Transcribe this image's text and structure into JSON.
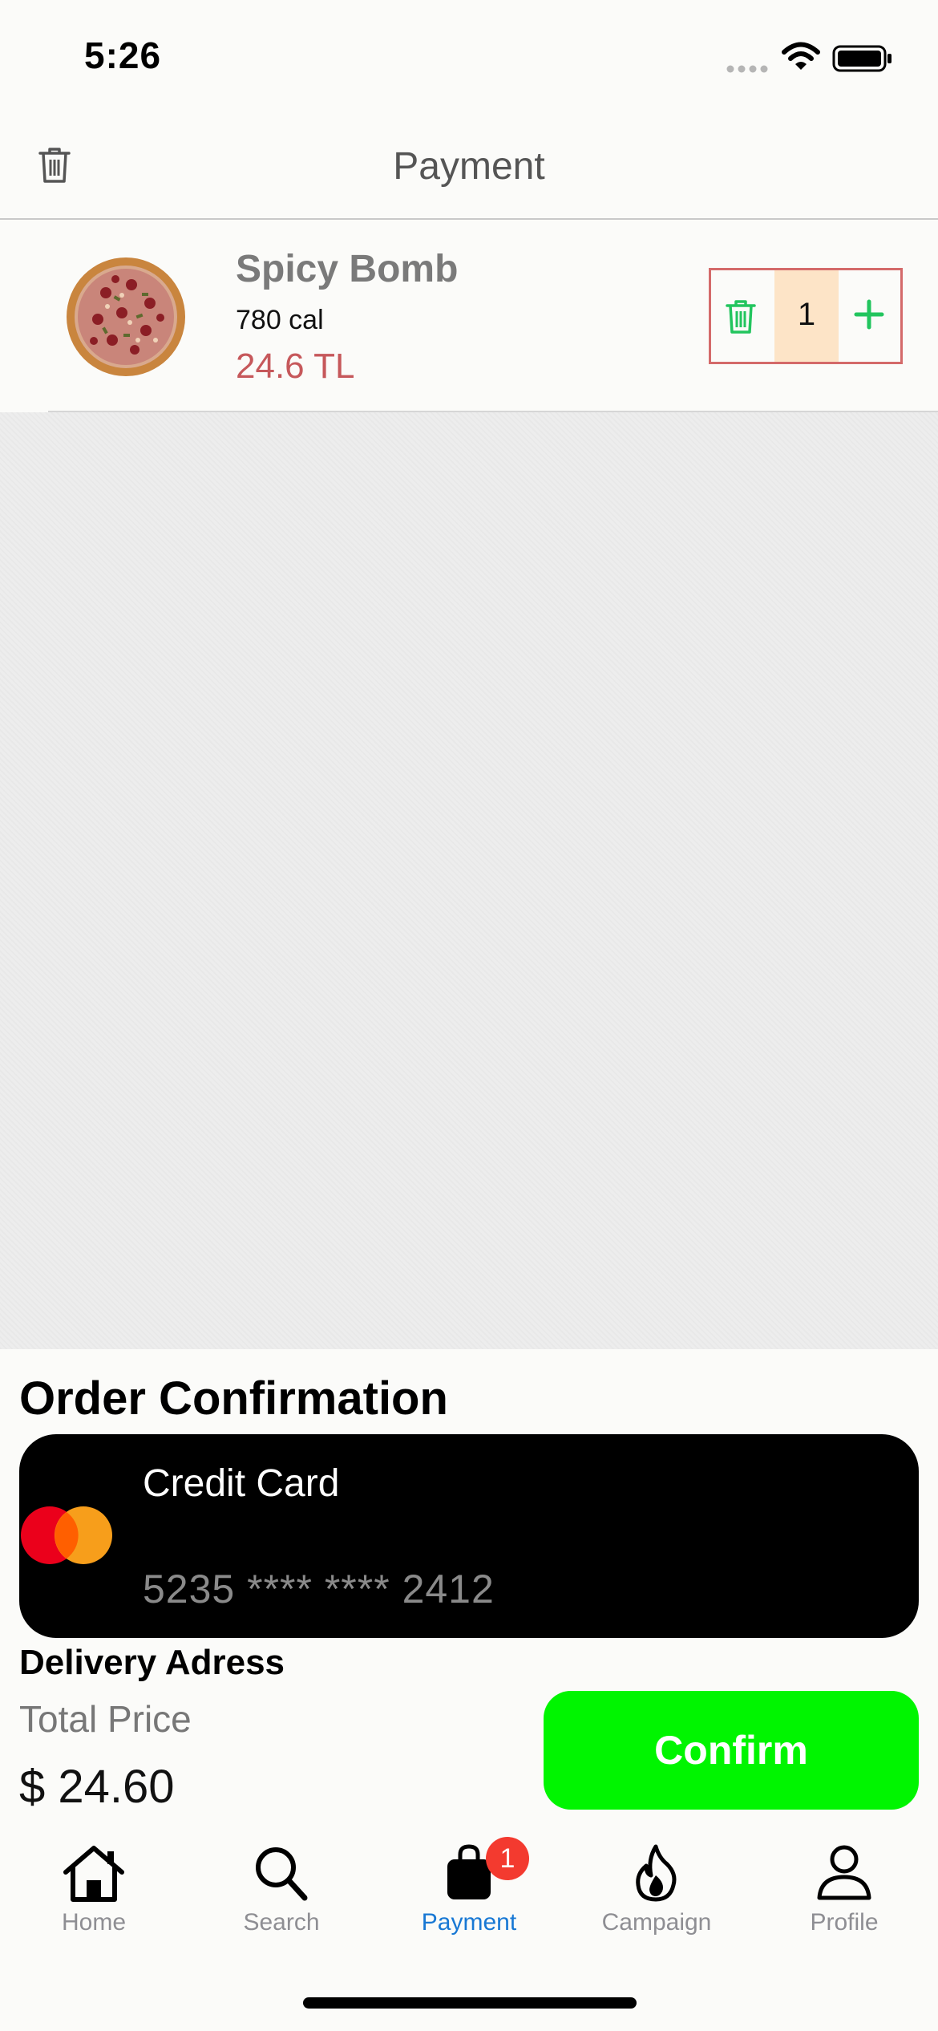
{
  "status_bar": {
    "time": "5:26"
  },
  "header": {
    "title": "Payment"
  },
  "cart": {
    "items": [
      {
        "name": "Spicy Bomb",
        "calories": "780 cal",
        "price": "24.6 TL",
        "quantity": "1"
      }
    ]
  },
  "order": {
    "heading": "Order Confirmation",
    "card": {
      "title": "Credit Card",
      "number": "5235 **** **** 2412"
    },
    "delivery_label": "Delivery Adress",
    "total_label": "Total Price",
    "total_value": "$ 24.60",
    "confirm_label": "Confirm"
  },
  "tabs": [
    {
      "label": "Home",
      "icon": "home-icon",
      "active": false
    },
    {
      "label": "Search",
      "icon": "search-icon",
      "active": false
    },
    {
      "label": "Payment",
      "icon": "shopping-bag-icon",
      "active": true,
      "badge": "1"
    },
    {
      "label": "Campaign",
      "icon": "flame-icon",
      "active": false
    },
    {
      "label": "Profile",
      "icon": "profile-icon",
      "active": false
    }
  ],
  "colors": {
    "accent_blue": "#1878d4",
    "confirm_green": "#00f500",
    "price_red": "#c6585b",
    "stepper_green": "#22c55e",
    "badge_red": "#f33a2f"
  }
}
